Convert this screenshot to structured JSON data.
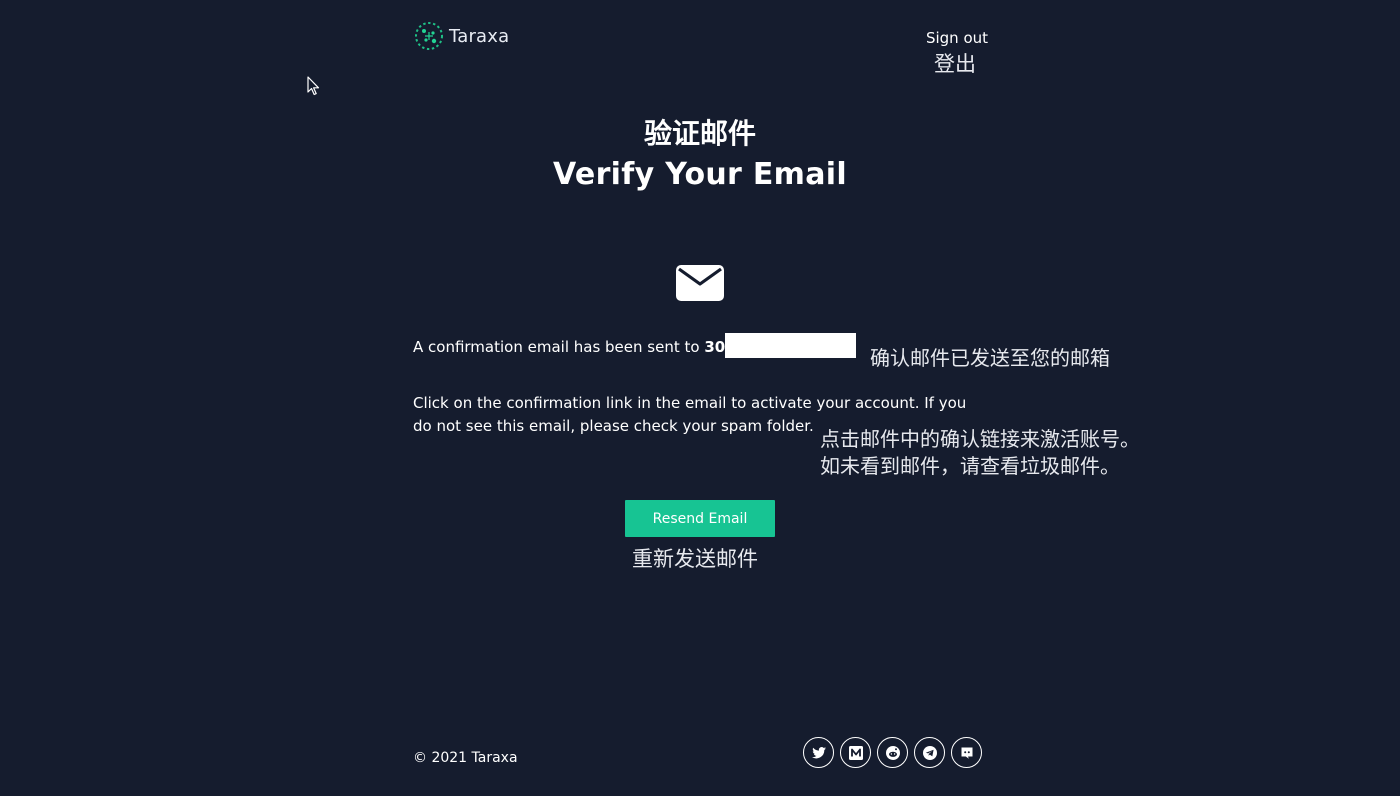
{
  "header": {
    "logo_text": "Taraxa",
    "signout_label": "Sign out",
    "signout_label_cn": "登出"
  },
  "main": {
    "title_cn": "验证邮件",
    "title_en": "Verify Your Email",
    "confirm_prefix": "A confirmation email has been sent to ",
    "confirm_email_visible": "304",
    "confirm_cn": "确认邮件已发送至您的邮箱",
    "instruction": "Click on the confirmation link in the email to activate your account. If you do not see this email, please check your spam folder.",
    "instruction_cn_line1": "点击邮件中的确认链接来激活账号。",
    "instruction_cn_line2": "如未看到邮件，请查看垃圾邮件。",
    "resend_label": "Resend Email",
    "resend_label_cn": "重新发送邮件"
  },
  "footer": {
    "copyright": "© 2021 Taraxa",
    "socials": [
      "twitter-icon",
      "medium-icon",
      "reddit-icon",
      "telegram-icon",
      "discord-icon"
    ]
  },
  "colors": {
    "background": "#151c2e",
    "accent": "#17c493",
    "text": "#ffffff"
  }
}
